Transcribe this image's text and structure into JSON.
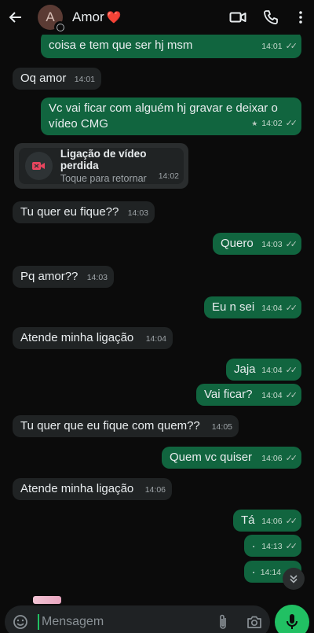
{
  "header": {
    "avatar_letter": "A",
    "title": "Amor",
    "title_emoji": "❤️",
    "icons": [
      "back-arrow-icon",
      "video-call-icon",
      "phone-icon",
      "more-vert-icon"
    ]
  },
  "messages": [
    {
      "side": "out",
      "text": "coisa e tem que ser hj msm",
      "time": "14:01",
      "read": true
    },
    {
      "side": "in",
      "text": "Oq amor",
      "time": "14:01"
    },
    {
      "side": "out",
      "text": "Vc vai ficar com alguém hj gravar e deixar o vídeo CMG",
      "time": "14:02",
      "read": true,
      "starred": true
    },
    {
      "side": "in",
      "text": "Tu quer eu fique??",
      "time": "14:03"
    },
    {
      "side": "out",
      "text": "Quero",
      "time": "14:03",
      "read": true
    },
    {
      "side": "in",
      "text": "Pq amor??",
      "time": "14:03"
    },
    {
      "side": "out",
      "text": "Eu n sei",
      "time": "14:04",
      "read": true
    },
    {
      "side": "in",
      "text": "Atende minha ligação",
      "time": "14:04"
    },
    {
      "side": "out",
      "text": "Jaja",
      "time": "14:04",
      "read": true
    },
    {
      "side": "out",
      "text": "Vai ficar?",
      "time": "14:04",
      "read": true
    },
    {
      "side": "in",
      "text": "Tu quer que eu fique com quem??",
      "time": "14:05"
    },
    {
      "side": "out",
      "text": "Quem vc quiser",
      "time": "14:06",
      "read": true
    },
    {
      "side": "in",
      "text": "Atende minha ligação",
      "time": "14:06"
    },
    {
      "side": "out",
      "text": "Tá",
      "time": "14:06",
      "read": true
    },
    {
      "side": "out",
      "text": ".",
      "time": "14:13",
      "read": true
    },
    {
      "side": "out",
      "text": ".",
      "time": "14:14",
      "read": false
    }
  ],
  "missed_call": {
    "title": "Ligação de vídeo perdida",
    "subtitle": "Toque para retornar",
    "time": "14:02"
  },
  "input": {
    "placeholder": "Mensagem"
  },
  "colors": {
    "outgoing_bubble": "#11653f",
    "incoming_bubble": "#202324",
    "accent": "#21c063",
    "background": "#0b0b0b"
  }
}
